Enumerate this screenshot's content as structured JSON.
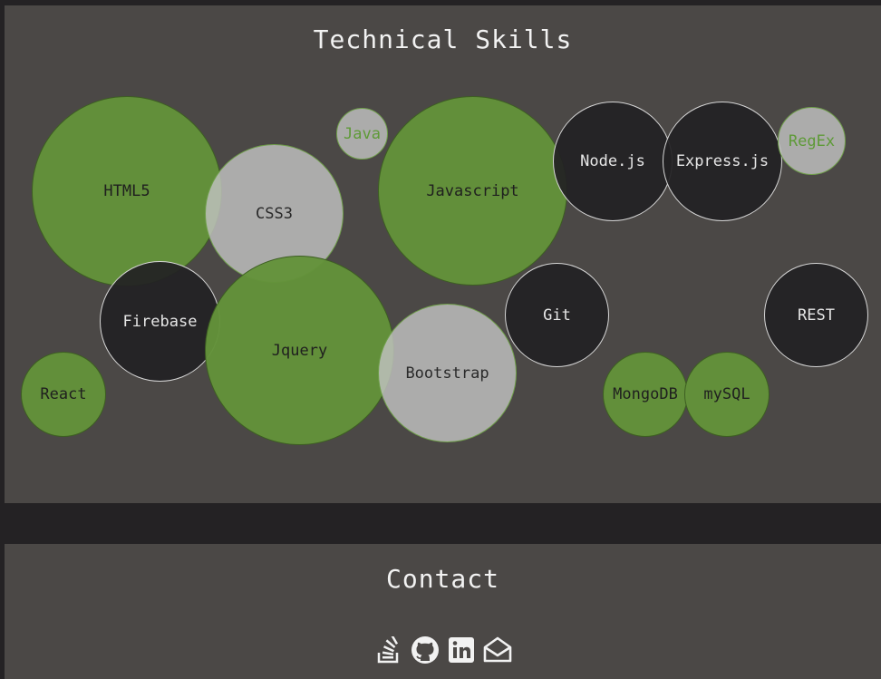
{
  "skills_section": {
    "title": "Technical Skills",
    "bubbles": [
      {
        "label": "HTML5",
        "style": "green"
      },
      {
        "label": "CSS3",
        "style": "light"
      },
      {
        "label": "Java",
        "style": "light-green-text"
      },
      {
        "label": "Javascript",
        "style": "green"
      },
      {
        "label": "Node.js",
        "style": "dark"
      },
      {
        "label": "Express.js",
        "style": "dark"
      },
      {
        "label": "RegEx",
        "style": "light-green-text"
      },
      {
        "label": "Firebase",
        "style": "dark"
      },
      {
        "label": "Jquery",
        "style": "green"
      },
      {
        "label": "Bootstrap",
        "style": "light"
      },
      {
        "label": "Git",
        "style": "dark"
      },
      {
        "label": "REST",
        "style": "dark"
      },
      {
        "label": "React",
        "style": "green"
      },
      {
        "label": "MongoDB",
        "style": "green"
      },
      {
        "label": "mySQL",
        "style": "green"
      }
    ]
  },
  "contact_section": {
    "title": "Contact",
    "icons": [
      "stackoverflow-icon",
      "github-icon",
      "linkedin-icon",
      "envelope-open-icon"
    ]
  },
  "colors": {
    "page_background": "#242224",
    "panel_background": "#4b4846",
    "bubble_green": "#63923a",
    "bubble_light": "#c2c2c2",
    "bubble_dark": "#222123",
    "title_text": "#f2f2f2"
  }
}
